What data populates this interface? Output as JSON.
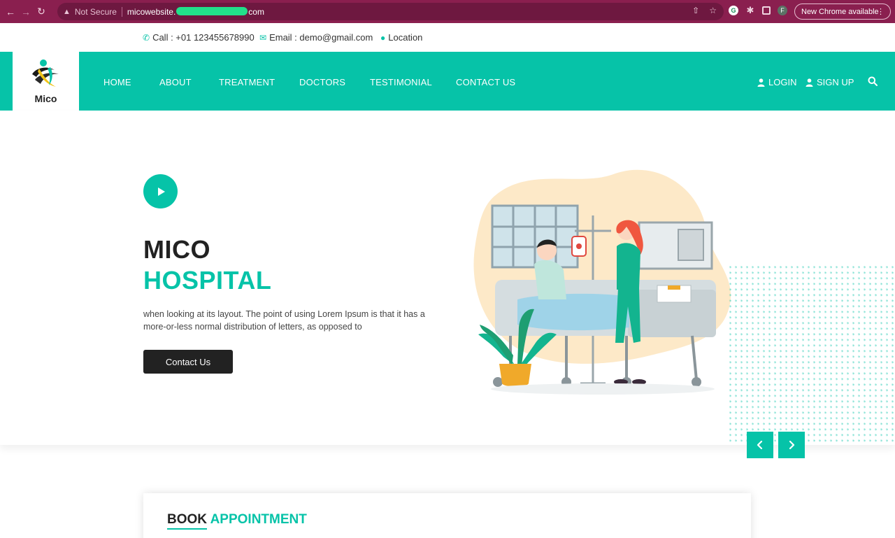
{
  "browser": {
    "security_label": "Not Secure",
    "url_prefix": "micowebsite.",
    "url_suffix": "com",
    "update_label": "New Chrome available",
    "avatar_letter": "F"
  },
  "topbar": {
    "call": "Call : +01 123455678990",
    "email": "Email : demo@gmail.com",
    "location": "Location"
  },
  "brand": {
    "name": "Mico"
  },
  "nav": {
    "items": [
      "HOME",
      "ABOUT",
      "TREATMENT",
      "DOCTORS",
      "TESTIMONIAL",
      "CONTACT US"
    ],
    "login": "LOGIN",
    "signup": "SIGN UP"
  },
  "hero": {
    "title_line1": "MICO",
    "title_line2": "HOSPITAL",
    "text": "when looking at its layout. The point of using Lorem Ipsum is that it has a more-or-less normal distribution of letters, as opposed to",
    "button": "Contact Us"
  },
  "appointment": {
    "title_part1": "BOOK",
    "title_part2": "APPOINTMENT"
  },
  "colors": {
    "accent": "#06c3a8",
    "dark": "#222222",
    "chrome": "#8a1f4f"
  }
}
